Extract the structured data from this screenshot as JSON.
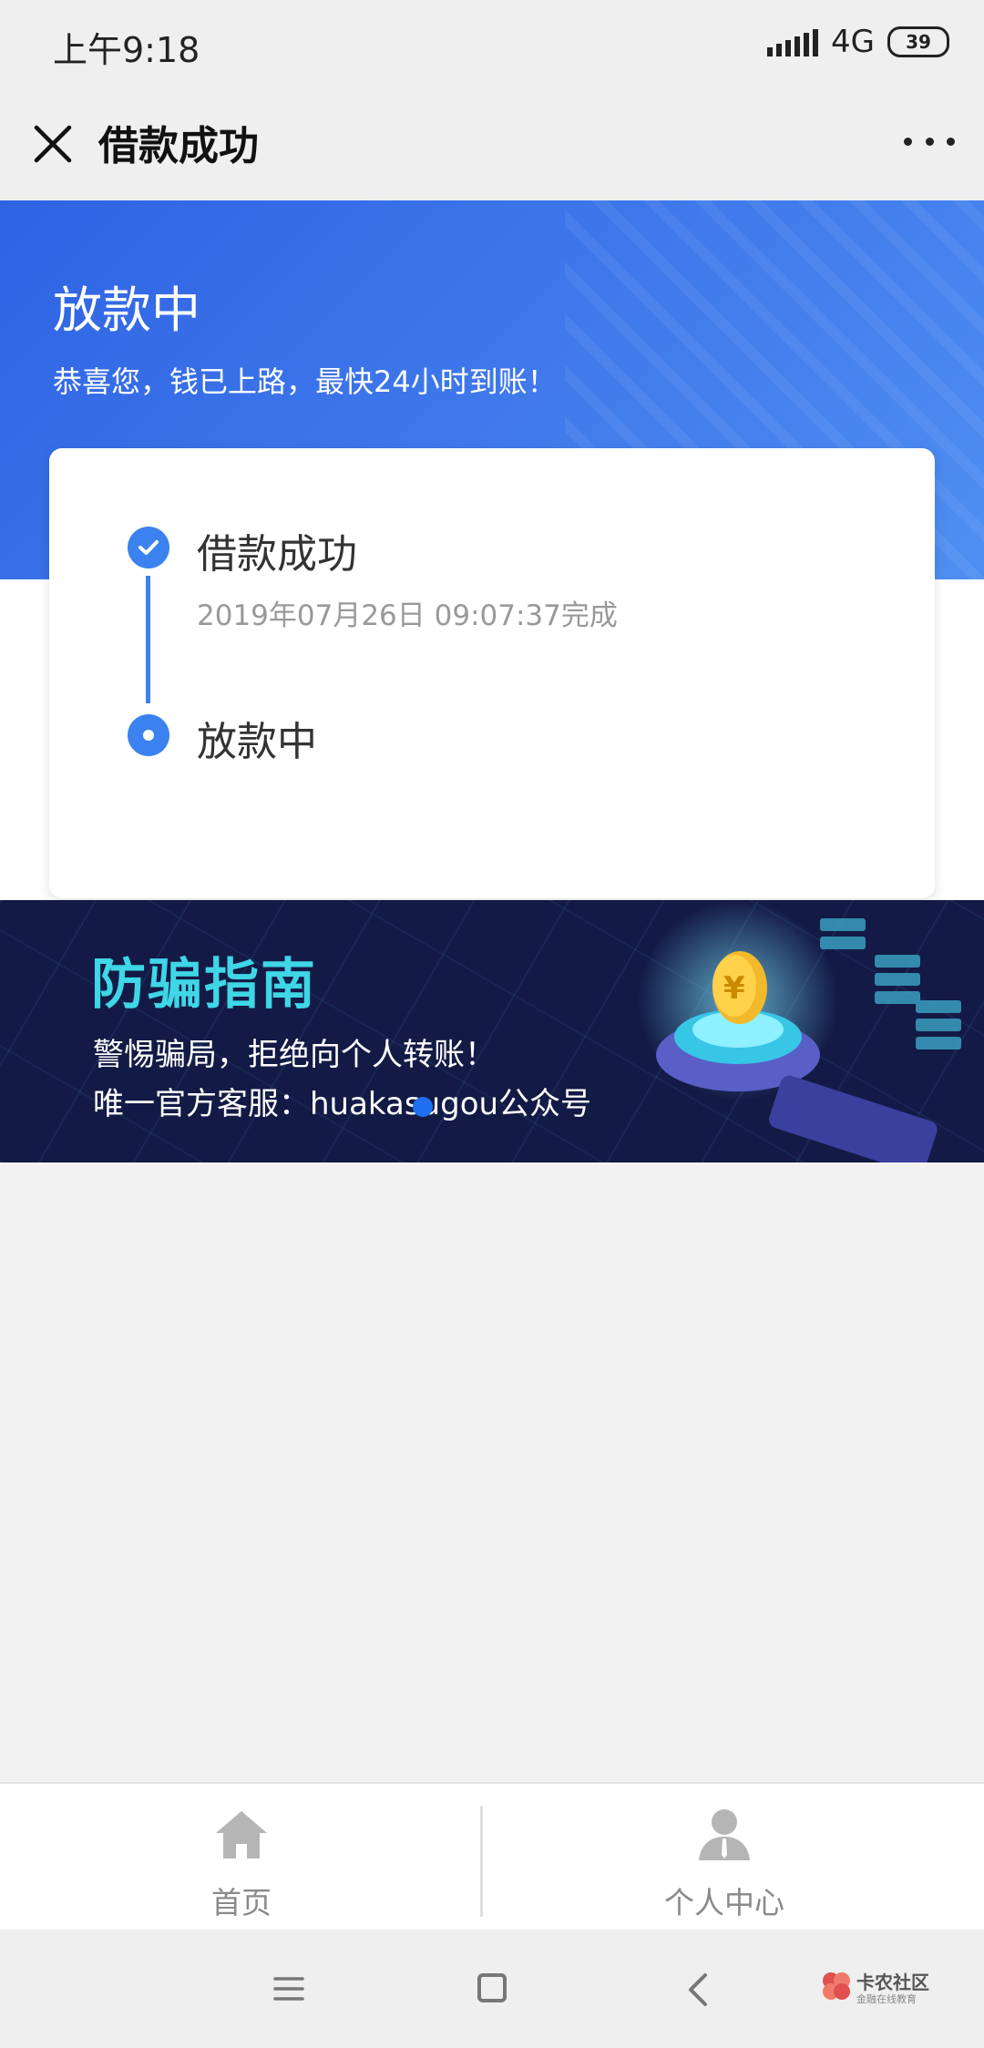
{
  "status_bar": {
    "time": "上午9:18",
    "network": "4G",
    "battery": "39"
  },
  "header": {
    "title": "借款成功",
    "close_icon": "close-icon",
    "more_icon": "more-icon"
  },
  "hero": {
    "title": "放款中",
    "subtitle": "恭喜您，钱已上路，最快24小时到账！",
    "background_color": "#3d76ea"
  },
  "progress": {
    "steps": [
      {
        "label": "借款成功",
        "time": "2019年07月26日 09:07:37完成",
        "state": "done"
      },
      {
        "label": "放款中",
        "state": "current"
      }
    ],
    "accent_color": "#3b82f0"
  },
  "banner": {
    "title": "防骗指南",
    "line1": "警惕骗局，拒绝向个人转账！",
    "line2": "唯一官方客服：huakasugou公众号",
    "icon": "yuan-coin-icon"
  },
  "tab_bar": {
    "items": [
      {
        "label": "首页",
        "icon": "home-icon"
      },
      {
        "label": "个人中心",
        "icon": "user-icon"
      }
    ]
  },
  "watermark": {
    "title": "卡农社区",
    "subtitle": "金融在线教育"
  }
}
